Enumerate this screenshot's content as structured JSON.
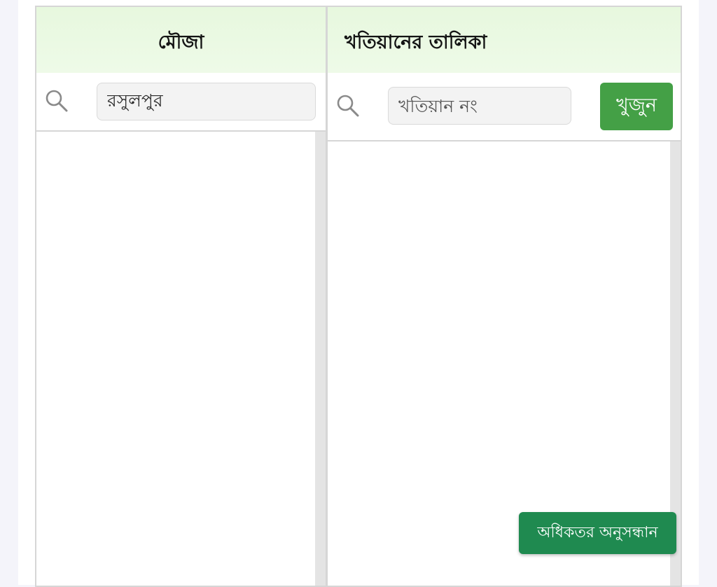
{
  "mouza_panel": {
    "title": "মৌজা",
    "search_value": "রসুলপুর",
    "search_icon": "search-icon"
  },
  "khatian_panel": {
    "title": "খতিয়ানের তালিকা",
    "search_placeholder": "খতিয়ান নং",
    "search_icon": "search-icon",
    "find_label": "খুজুন"
  },
  "advanced_search_label": "অধিকতর অনুসন্ধান",
  "colors": {
    "header_bg": "#e8f8df",
    "find_button": "#44a046",
    "advanced_button": "#1f8a50"
  }
}
